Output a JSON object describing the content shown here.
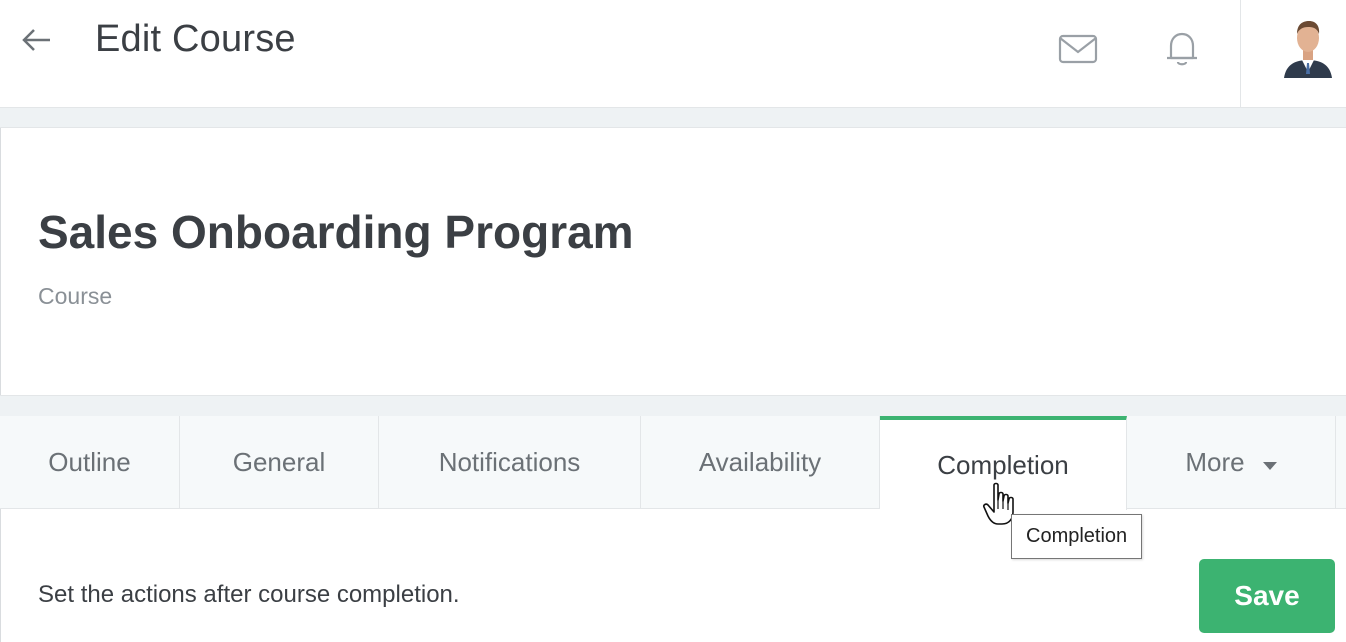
{
  "topbar": {
    "title": "Edit Course",
    "back_icon": "arrow-left-icon",
    "mail_icon": "mail-icon",
    "bell_icon": "bell-icon",
    "avatar": "user-avatar"
  },
  "course": {
    "title": "Sales Onboarding Program",
    "type": "Course"
  },
  "tabs": [
    {
      "label": "Outline"
    },
    {
      "label": "General"
    },
    {
      "label": "Notifications"
    },
    {
      "label": "Availability"
    },
    {
      "label": "Completion",
      "active": true
    },
    {
      "label": "More",
      "has_dropdown": true
    }
  ],
  "content": {
    "description": "Set the actions after course completion.",
    "save_label": "Save"
  },
  "tooltip": {
    "text": "Completion"
  },
  "colors": {
    "accent": "#3cb371",
    "band": "#eef2f4",
    "text": "#3b3f44",
    "muted": "#8a9096"
  }
}
